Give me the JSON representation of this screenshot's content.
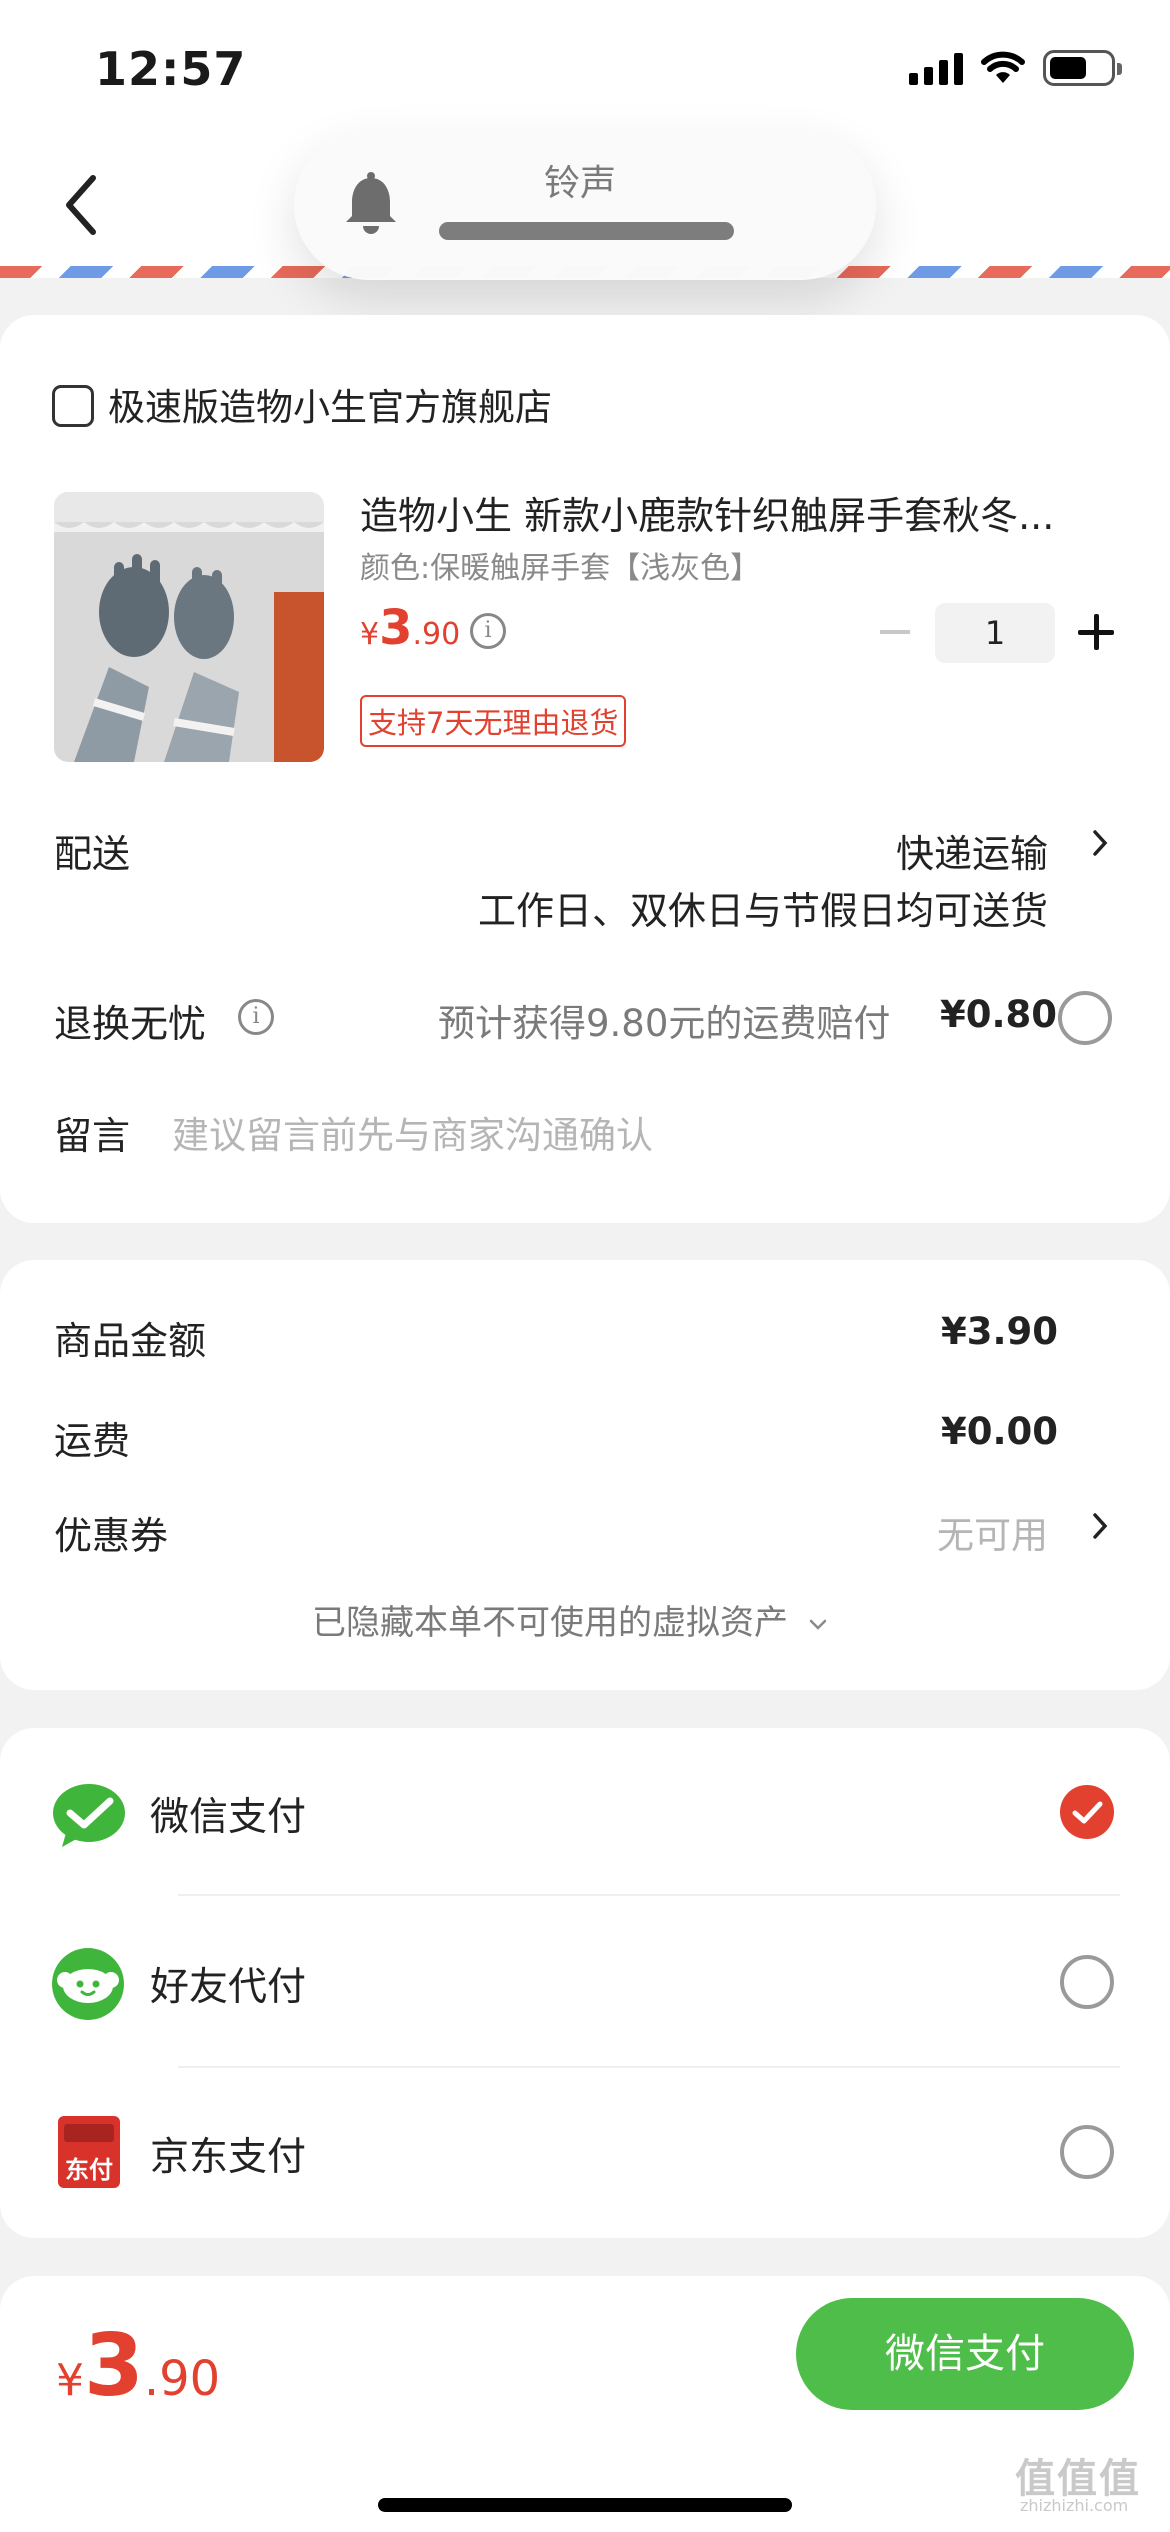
{
  "status_bar": {
    "time": "12:57"
  },
  "header": {
    "ringer_label": "铃声"
  },
  "store": {
    "name": "极速版造物小生官方旗舰店"
  },
  "product": {
    "name": "造物小生 新款小鹿款针织触屏手套秋冬...",
    "spec": "颜色:保暖触屏手套【浅灰色】",
    "price_symbol": "¥",
    "price_int": "3",
    "price_dec": ".90",
    "quantity": "1",
    "return_badge": "支持7天无理由退货"
  },
  "delivery": {
    "label": "配送",
    "method": "快递运输",
    "note": "工作日、双休日与节假日均可送货"
  },
  "return_ins": {
    "label": "退换无忧",
    "desc": "预计获得9.80元的运费赔付",
    "price": "¥0.80"
  },
  "message": {
    "label": "留言",
    "placeholder": "建议留言前先与商家沟通确认"
  },
  "summary": {
    "goods_label": "商品金额",
    "goods_value": "¥3.90",
    "shipping_label": "运费",
    "shipping_value": "¥0.00",
    "coupon_label": "优惠券",
    "coupon_value": "无可用",
    "hidden_note": "已隐藏本单不可使用的虚拟资产"
  },
  "payment_methods": [
    {
      "label": "微信支付",
      "icon": "wechat-pay-icon",
      "selected": true
    },
    {
      "label": "好友代付",
      "icon": "friend-pay-icon",
      "selected": false
    },
    {
      "label": "京东支付",
      "icon": "jd-pay-icon",
      "selected": false
    }
  ],
  "jd_icon_text": "东付",
  "bottom": {
    "price_symbol": "¥",
    "price_int": "3",
    "price_dec": ".90",
    "pay_button": "微信支付"
  },
  "watermark": {
    "text": "值值值",
    "sub": "zhizhizhi.com"
  },
  "colors": {
    "accent_red": "#e2412f",
    "wechat_green": "#4fbd4a"
  }
}
